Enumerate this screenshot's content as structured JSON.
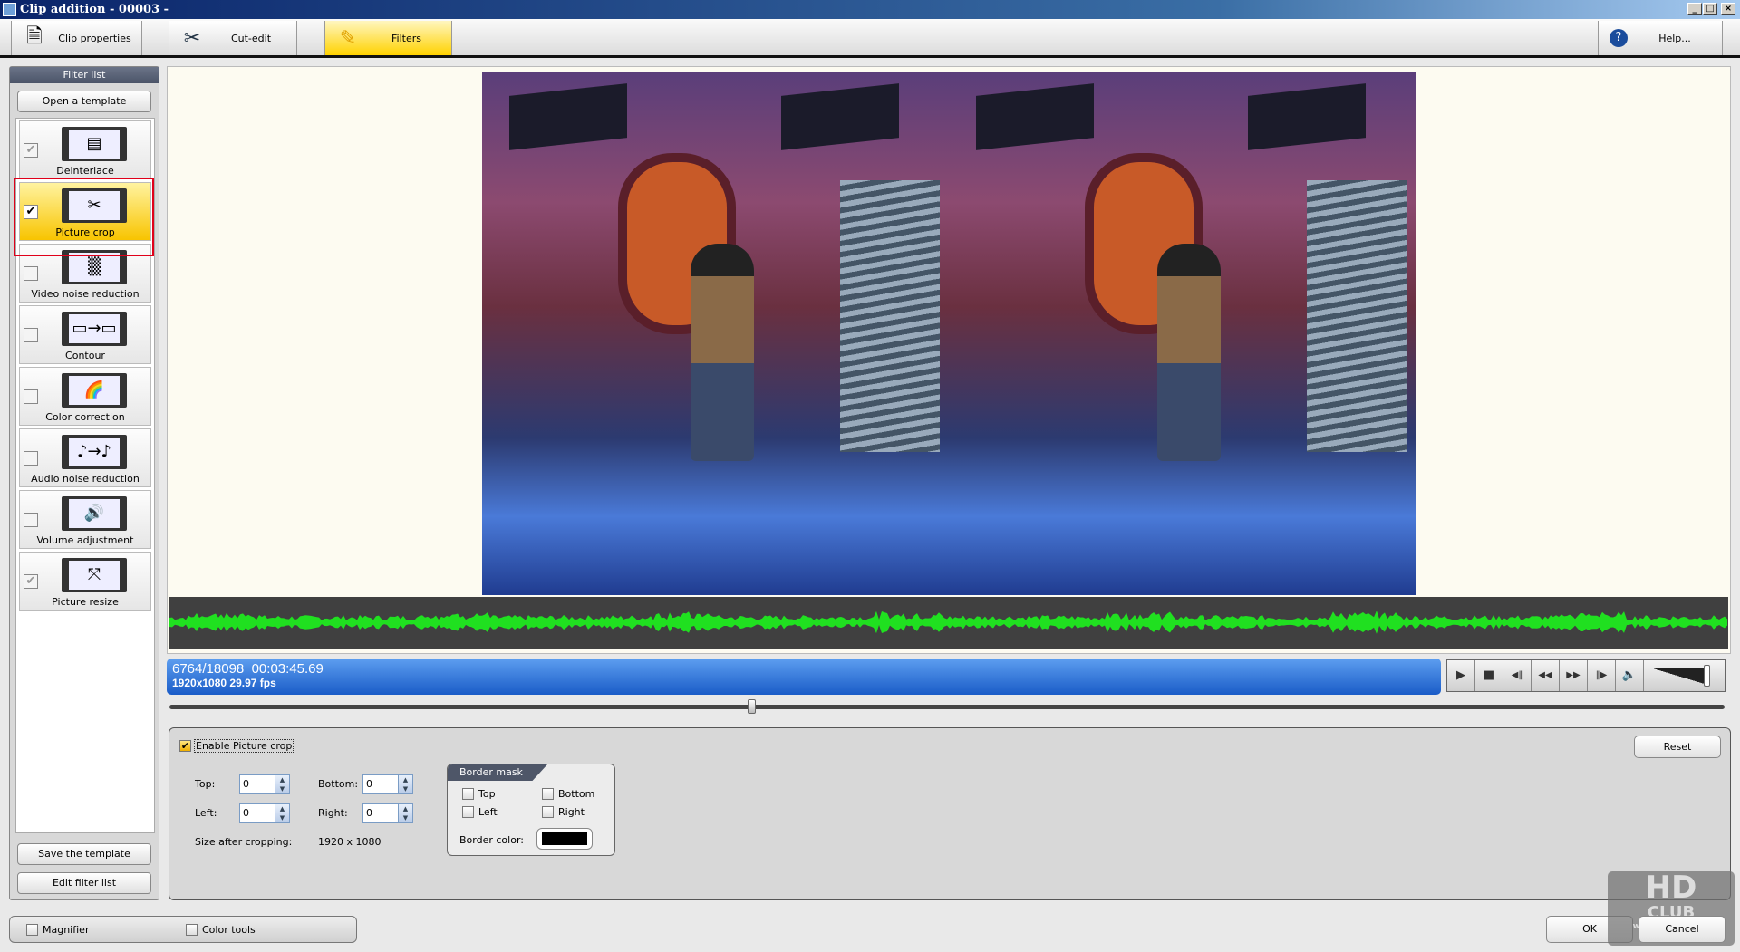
{
  "window": {
    "title": "Clip addition - 00003 -",
    "controls": [
      "_",
      "□",
      "×"
    ]
  },
  "toolbar": {
    "tabs": [
      {
        "label": "Clip properties",
        "icon": "document-icon"
      },
      {
        "label": "Cut-edit",
        "icon": "scissors-icon"
      },
      {
        "label": "Filters",
        "icon": "filter-icon"
      }
    ],
    "help": "Help..."
  },
  "sidebar": {
    "header": "Filter list",
    "open_template": "Open a template",
    "save_template": "Save the template",
    "edit_list": "Edit filter list",
    "filters": [
      {
        "name": "Deinterlace",
        "checked": true,
        "glyph": "▤"
      },
      {
        "name": "Picture crop",
        "checked": true,
        "glyph": "✂"
      },
      {
        "name": "Video noise reduction",
        "checked": false,
        "glyph": "▒"
      },
      {
        "name": "Contour",
        "checked": false,
        "glyph": "▭→▭"
      },
      {
        "name": "Color correction",
        "checked": false,
        "glyph": "🌈"
      },
      {
        "name": "Audio noise reduction",
        "checked": false,
        "glyph": "♪→♪"
      },
      {
        "name": "Volume adjustment",
        "checked": false,
        "glyph": "🔊"
      },
      {
        "name": "Picture resize",
        "checked": true,
        "glyph": "⤧"
      }
    ]
  },
  "info": {
    "frame": "6764/18098",
    "timecode": "00:03:45.69",
    "format": "1920x1080 29.97  fps"
  },
  "transport": [
    "▶",
    "■",
    "◀‖",
    "◀◀",
    "▶▶",
    "‖▶",
    "🔈"
  ],
  "seek_fraction": 0.374,
  "volume_fraction": 0.95,
  "crop": {
    "enable_label": "Enable Picture crop",
    "top_label": "Top:",
    "bottom_label": "Bottom:",
    "left_label": "Left:",
    "right_label": "Right:",
    "top": "0",
    "bottom": "0",
    "left": "0",
    "right": "0",
    "size_label": "Size after cropping:",
    "size_value": "1920 x 1080",
    "reset": "Reset"
  },
  "border_mask": {
    "title": "Border mask",
    "top": "Top",
    "bottom": "Bottom",
    "left": "Left",
    "right": "Right",
    "color_label": "Border color:",
    "color": "#000000"
  },
  "bottom": {
    "magnifier": "Magnifier",
    "color_tools": "Color tools",
    "ok": "OK",
    "cancel": "Cancel"
  },
  "watermark": {
    "line1": "HD",
    "line2": "CLUB",
    "line3": "www.HD.Club.tw"
  }
}
